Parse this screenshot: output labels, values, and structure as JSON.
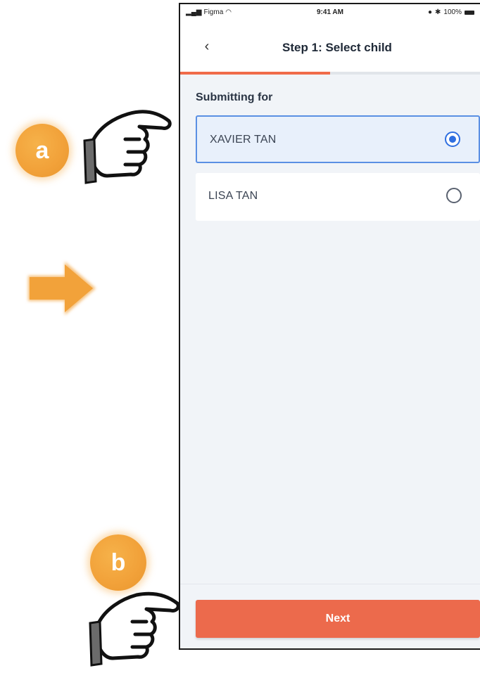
{
  "status_bar": {
    "carrier": "Figma",
    "time": "9:41 AM",
    "battery": "100%"
  },
  "header": {
    "title": "Step 1: Select child",
    "progress": 0.5
  },
  "section": {
    "label": "Submitting for"
  },
  "options": [
    {
      "label": "XAVIER TAN",
      "selected": true
    },
    {
      "label": "LISA TAN",
      "selected": false
    }
  ],
  "footer": {
    "next_label": "Next"
  },
  "callouts": {
    "a_label": "a",
    "b_label": "b",
    "accent_color": "#f2a23a"
  }
}
